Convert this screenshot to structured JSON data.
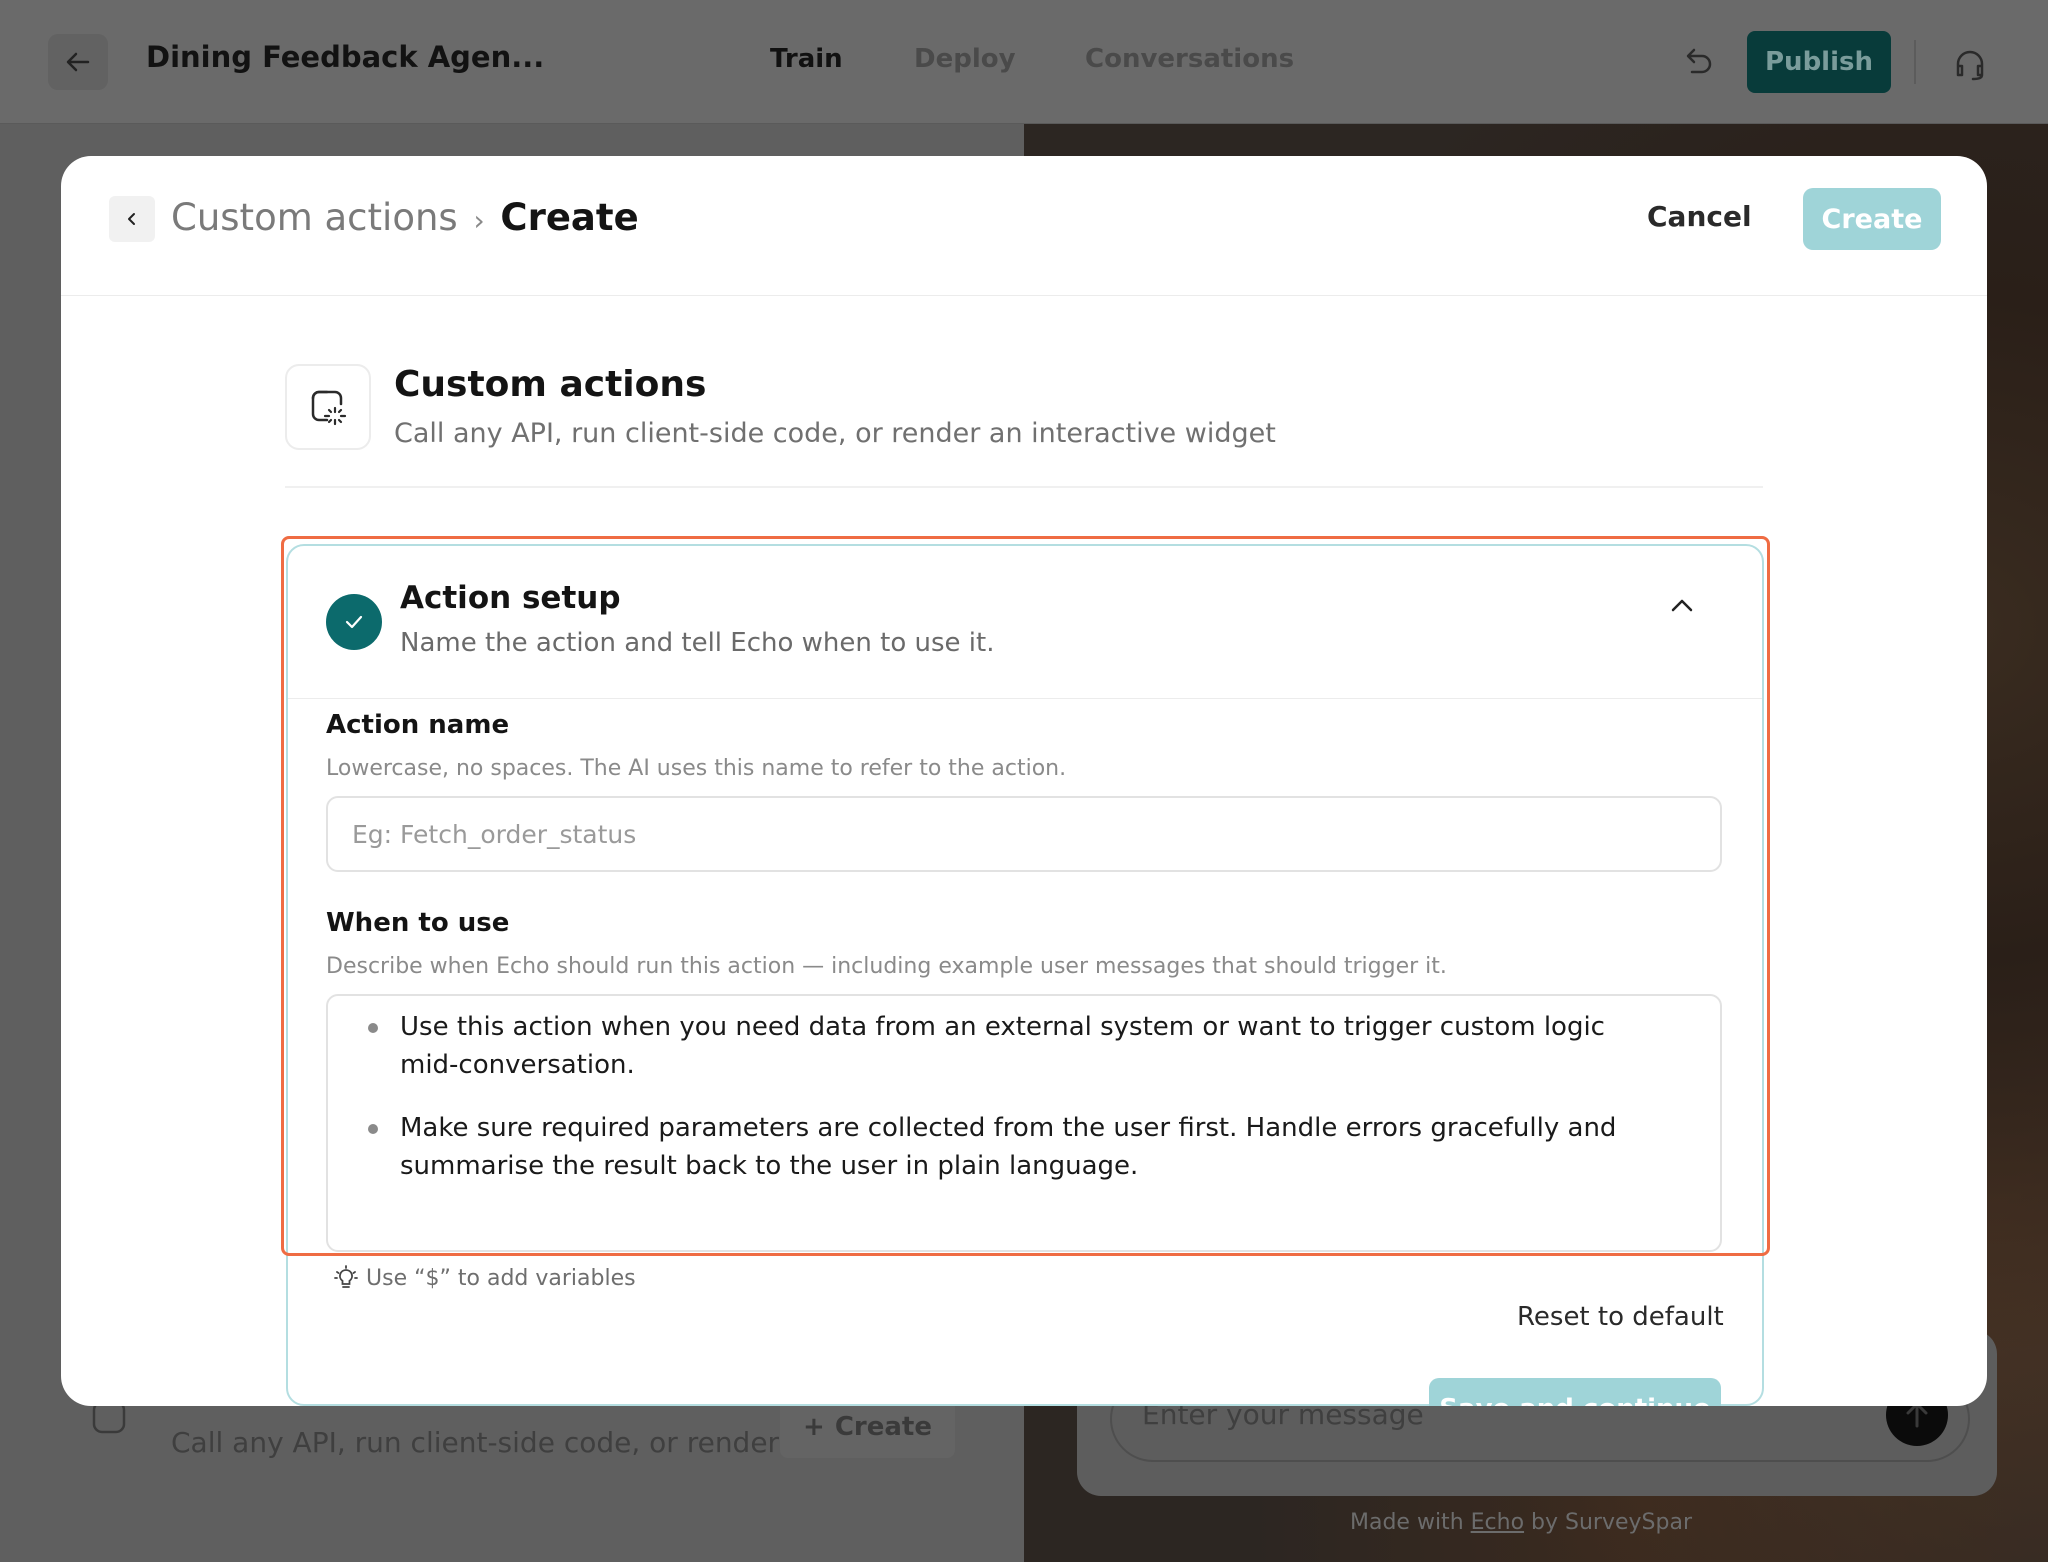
{
  "app": {
    "title": "Dining Feedback Agen...",
    "tabs": [
      "Train",
      "Deploy",
      "Conversations"
    ],
    "active_tab": "Train",
    "publish_label": "Publish"
  },
  "background": {
    "left_card_sub": "Call any API, run client-side code, or render a...",
    "left_card_create": "Create",
    "chat_placeholder": "Enter your message",
    "made_with_prefix": "Made with",
    "made_with_brand": "Echo",
    "made_with_suffix": "by SurveySpar"
  },
  "modal": {
    "breadcrumb_parent": "Custom actions",
    "breadcrumb_sep": "›",
    "breadcrumb_current": "Create",
    "cancel_label": "Cancel",
    "create_label": "Create",
    "section_title": "Custom actions",
    "section_subtitle": "Call any API, run client-side code, or render an interactive widget",
    "panel": {
      "title": "Action setup",
      "subtitle": "Name the action and tell Echo when to use it.",
      "action_name": {
        "label": "Action name",
        "help": "Lowercase, no spaces. The AI uses this name to refer to the action.",
        "placeholder": "Eg: Fetch_order_status",
        "value": ""
      },
      "when_to_use": {
        "label": "When to use",
        "help": "Describe when Echo should run this action — including example user messages that should trigger it.",
        "bullets": [
          "Use this action when you need data from an external system or want to trigger custom logic mid-conversation.",
          "Make sure required parameters are collected from the user first. Handle errors gracefully and summarise the result back to the user in plain language."
        ]
      },
      "hint": "Use “$” to add variables",
      "reset_label": "Reset to default",
      "save_label": "Save and continue"
    }
  },
  "colors": {
    "accent_teal": "#0c6a6c",
    "button_disabled": "#9fd4d8",
    "highlight": "#ef6c43",
    "panel_border": "#b4dee1"
  }
}
